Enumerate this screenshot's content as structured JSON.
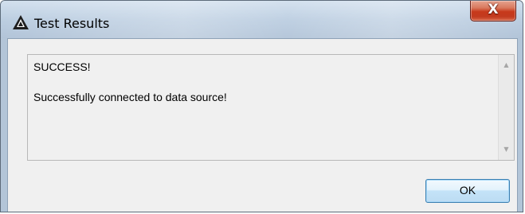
{
  "window": {
    "title": "Test Results",
    "close_label": "X"
  },
  "message": {
    "text": "SUCCESS!\n\nSuccessfully connected to data source!"
  },
  "buttons": {
    "ok_label": "OK"
  },
  "icons": {
    "app": "app-logo-icon",
    "close": "close-icon",
    "scroll_up": "scroll-up-arrow-icon",
    "scroll_down": "scroll-down-arrow-icon"
  }
}
